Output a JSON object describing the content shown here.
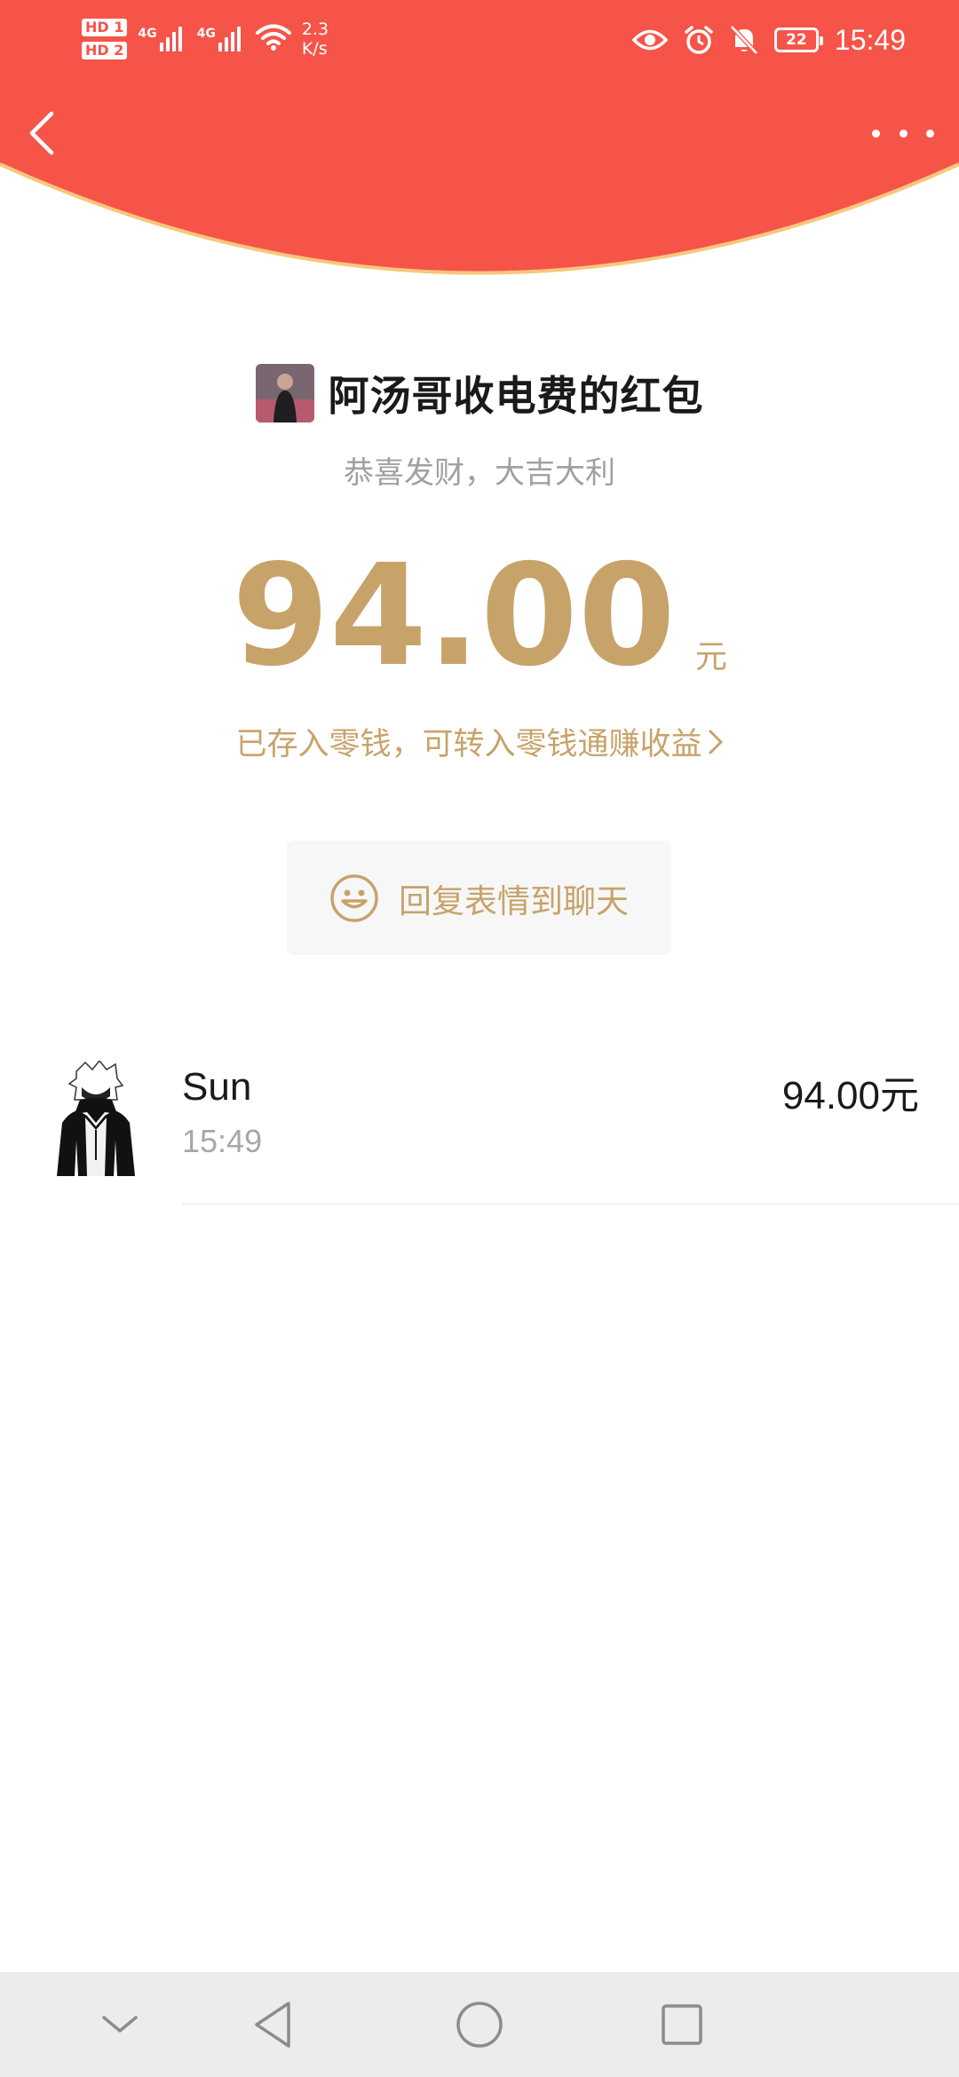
{
  "status_bar": {
    "hd1": "HD 1",
    "hd2": "HD 2",
    "net1": "4G",
    "net2": "4G",
    "speed_value": "2.3",
    "speed_unit": "K/s",
    "battery": "22",
    "time": "15:49",
    "icons": [
      "eye-icon",
      "alarm-icon",
      "mute-icon",
      "battery-icon"
    ]
  },
  "colors": {
    "header_red": "#f65449",
    "header_rim": "#f7c77b",
    "gold": "#c7a36a"
  },
  "header": {
    "back_icon": "chevron-left-icon",
    "more_icon": "more-dots-icon"
  },
  "packet": {
    "title": "阿汤哥收电费的红包",
    "greeting": "恭喜发财，大吉大利",
    "amount": "94.00",
    "unit": "元",
    "saved_note": "已存入零钱，可转入零钱通赚收益",
    "saved_note_icon": "chevron-right-icon"
  },
  "reply": {
    "icon": "smile-icon",
    "label": "回复表情到聊天"
  },
  "records": [
    {
      "name": "Sun",
      "time": "15:49",
      "amount": "94.00元"
    }
  ],
  "nav_bar": {
    "items": [
      "collapse-icon",
      "back-triangle-icon",
      "home-circle-icon",
      "recents-square-icon"
    ]
  }
}
